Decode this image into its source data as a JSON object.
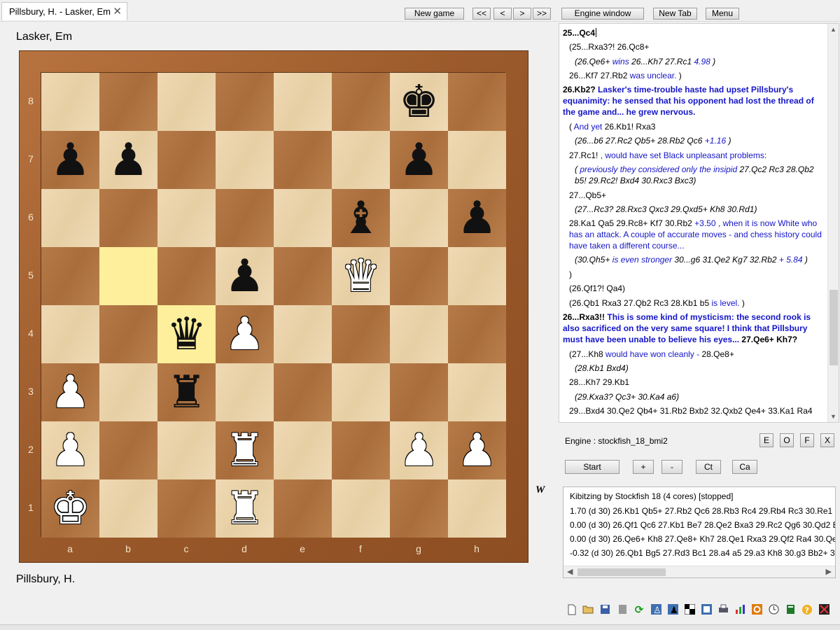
{
  "tabs": {
    "active": "Pillsbury, H. - Lasker, Em"
  },
  "toolbar": {
    "new_game": "New game",
    "first": "<<",
    "prev": "<",
    "next": ">",
    "last": ">>",
    "engine_window": "Engine window",
    "new_tab": "New Tab",
    "menu": "Menu"
  },
  "players": {
    "top": "Lasker, Em",
    "bottom": "Pillsbury, H."
  },
  "board": {
    "files": [
      "a",
      "b",
      "c",
      "d",
      "e",
      "f",
      "g",
      "h"
    ],
    "ranks": [
      "8",
      "7",
      "6",
      "5",
      "4",
      "3",
      "2",
      "1"
    ],
    "highlight": [
      "b5",
      "c4"
    ],
    "side_to_move": "W",
    "pieces": [
      {
        "sq": "g8",
        "p": "k"
      },
      {
        "sq": "a7",
        "p": "p"
      },
      {
        "sq": "b7",
        "p": "p"
      },
      {
        "sq": "g7",
        "p": "p"
      },
      {
        "sq": "f6",
        "p": "b"
      },
      {
        "sq": "h6",
        "p": "p"
      },
      {
        "sq": "d5",
        "p": "p"
      },
      {
        "sq": "f5",
        "p": "Q"
      },
      {
        "sq": "c4",
        "p": "q"
      },
      {
        "sq": "d4",
        "p": "P"
      },
      {
        "sq": "a3",
        "p": "P"
      },
      {
        "sq": "c3",
        "p": "r"
      },
      {
        "sq": "a2",
        "p": "P"
      },
      {
        "sq": "d2",
        "p": "R"
      },
      {
        "sq": "g2",
        "p": "P"
      },
      {
        "sq": "h2",
        "p": "P"
      },
      {
        "sq": "a1",
        "p": "K"
      },
      {
        "sq": "d1",
        "p": "R"
      }
    ]
  },
  "notation": {
    "l1": "25...Qc4",
    "l2": "(25...Rxa3?! 26.Qc8+",
    "l3a": "(26.Qe6+",
    "l3b": " wins ",
    "l3c": "26...Kh7 27.Rc1",
    "l3d": " 4.98",
    "l3e": " )",
    "l4a": "26...Kf7 27.Rb2",
    "l4b": " was unclear.",
    "l4c": " )",
    "l5a": "26.Kb2?",
    "l5b": " Lasker's time-trouble haste had upset Pillsbury's equanimity: he sensed that his opponent had lost the thread of the game and... he grew nervous.",
    "l6a": "( ",
    "l6b": "And yet",
    "l6c": " 26.Kb1! Rxa3",
    "l7a": "(26...b6 27.Rc2 Qb5+ 28.Rb2 Qc6",
    "l7b": " +1.16",
    "l7c": " )",
    "l8a": "27.Rc1!",
    "l8b": " , would have set Black unpleasant problems:",
    "l9a": "( ",
    "l9b": "previously they considered only the insipid",
    "l9c": " 27.Qc2 Rc3 28.Qb2 b5!",
    "l9d": " 29.Rc2! Bxd4 30.Rxc3 Bxc3)",
    "l10": "27...Qb5+",
    "l11": "(27...Rc3? 28.Rxc3 Qxc3 29.Qxd5+ Kh8 30.Rd1)",
    "l12a": "28.Ka1 Qa5 29.Rc8+ Kf7 30.Rb2",
    "l12b": " +3.50 , when it is now White who has an attack. A couple of accurate moves - and chess history could have taken a different course...",
    "l13a": "(30.Qh5+",
    "l13b": " is even stronger",
    "l13c": " 30...g6 31.Qe2 Kg7 32.Rb2",
    "l13d": " + 5.84",
    "l13e": " )",
    "l14": ")",
    "l15": "(26.Qf1?! Qa4)",
    "l16a": "(26.Qb1 Rxa3 27.Qb2 Rc3 28.Kb1 b5",
    "l16b": " is level.",
    "l16c": " )",
    "l17a": "26...Rxa3!!",
    "l17b": " This is some kind of mysticism: the second rook is also sacrificed on the very same square! I think that Pillsbury must have been unable to believe his eyes...",
    "l17c": " 27.Qe6+ Kh7?",
    "l18a": "(27...Kh8",
    "l18b": " would have won cleanly -",
    "l18c": " 28.Qe8+",
    "l19": "(28.Kb1 Bxd4)",
    "l20": "28...Kh7 29.Kb1",
    "l21": "(29.Kxa3? Qc3+ 30.Ka4 a6)",
    "l22": "29...Bxd4 30.Qe2 Qb4+ 31.Rb2 Bxb2 32.Qxb2 Qe4+ 33.Ka1 Ra4"
  },
  "engine": {
    "label": "Engine  :  stockfish_18_bmi2",
    "btn_e": "E",
    "btn_o": "O",
    "btn_f": "F",
    "btn_x": "X",
    "start": "Start",
    "plus": "+",
    "minus": "-",
    "ct": "Ct",
    "ca": "Ca",
    "kibitz_header": "Kibitzing by  Stockfish 18  (4 cores)  [stopped]",
    "lines": [
      "1.70 (d 30) 26.Kb1 Qb5+ 27.Rb2 Qc6 28.Rb3 Rc4 29.Rb4 Rc3 30.Re1 b",
      "0.00 (d 30) 26.Qf1 Qc6 27.Kb1 Be7 28.Qe2 Bxa3 29.Rc2 Qg6 30.Qd2 B",
      "0.00 (d 30) 26.Qe6+ Kh8 27.Qe8+ Kh7 28.Qe1 Rxa3 29.Qf2 Ra4 30.Qe",
      "-0.32 (d 30) 26.Qb1 Bg5 27.Rd3 Bc1 28.a4 a5 29.a3 Kh8 30.g3 Bb2+ 3"
    ]
  },
  "bottom_toolbar": [
    "new-doc",
    "open-folder",
    "save",
    "grey-doc",
    "refresh",
    "white-piece",
    "black-piece",
    "board",
    "board-view",
    "printer",
    "chart",
    "orange-square",
    "clock",
    "book",
    "help",
    "flag"
  ],
  "colors": {
    "comment_blue": "#1515c8",
    "highlight": "#fdef9c",
    "light_square": "#e9d2a8",
    "dark_square": "#ae733f"
  }
}
